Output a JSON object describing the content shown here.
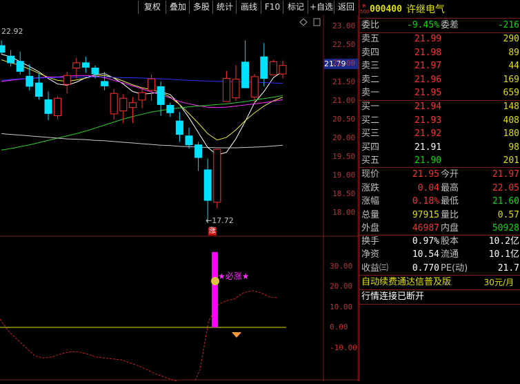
{
  "toolbar": {
    "buttons": [
      "复权",
      "叠加",
      "多股",
      "统计",
      "画线",
      "F10",
      "标记",
      "+自选",
      "返回"
    ]
  },
  "chart_data": {
    "type": "candlestick",
    "y_ticks": [
      "23.00",
      "22.50",
      "22.00",
      "21.50",
      "21.00",
      "20.50",
      "20.00",
      "19.50",
      "19.00",
      "18.50",
      "18.00"
    ],
    "high_label": "22.92",
    "low_label": "17.72",
    "current_price_tag": "21.79",
    "limit_up_marker": "涨",
    "candles": [
      {
        "o": 22.48,
        "h": 22.62,
        "l": 22.25,
        "c": 22.3
      },
      {
        "o": 22.2,
        "h": 22.36,
        "l": 21.92,
        "c": 22.02
      },
      {
        "o": 22.06,
        "h": 22.32,
        "l": 21.7,
        "c": 21.79
      },
      {
        "o": 21.66,
        "h": 21.98,
        "l": 21.28,
        "c": 21.39
      },
      {
        "o": 21.48,
        "h": 21.73,
        "l": 21.03,
        "c": 21.12
      },
      {
        "o": 21.03,
        "h": 21.25,
        "l": 20.48,
        "c": 20.66
      },
      {
        "o": 20.6,
        "h": 21.12,
        "l": 20.5,
        "c": 21.07
      },
      {
        "o": 21.44,
        "h": 21.78,
        "l": 21.2,
        "c": 21.68
      },
      {
        "o": 21.88,
        "h": 22.15,
        "l": 21.6,
        "c": 22.02
      },
      {
        "o": 22.02,
        "h": 22.18,
        "l": 21.75,
        "c": 21.9
      },
      {
        "o": 21.88,
        "h": 21.95,
        "l": 21.6,
        "c": 21.72
      },
      {
        "o": 21.52,
        "h": 21.78,
        "l": 21.28,
        "c": 21.4
      },
      {
        "o": 20.65,
        "h": 21.32,
        "l": 20.5,
        "c": 21.2
      },
      {
        "o": 20.73,
        "h": 21.18,
        "l": 20.4,
        "c": 21.07
      },
      {
        "o": 20.82,
        "h": 21.1,
        "l": 20.4,
        "c": 20.95
      },
      {
        "o": 21.02,
        "h": 21.37,
        "l": 20.8,
        "c": 21.22
      },
      {
        "o": 21.28,
        "h": 21.71,
        "l": 21.0,
        "c": 21.59
      },
      {
        "o": 21.38,
        "h": 21.52,
        "l": 20.6,
        "c": 20.9
      },
      {
        "o": 20.88,
        "h": 20.95,
        "l": 20.57,
        "c": 20.68
      },
      {
        "o": 20.46,
        "h": 20.7,
        "l": 19.9,
        "c": 20.1
      },
      {
        "o": 20.06,
        "h": 20.28,
        "l": 19.72,
        "c": 19.82
      },
      {
        "o": 19.82,
        "h": 19.9,
        "l": 19.12,
        "c": 19.48
      },
      {
        "o": 19.15,
        "h": 19.45,
        "l": 17.72,
        "c": 18.33
      },
      {
        "o": 18.28,
        "h": 19.5,
        "l": 18.12,
        "c": 19.7
      },
      {
        "o": 20.98,
        "h": 21.8,
        "l": 20.98,
        "c": 21.6
      },
      {
        "o": 21.08,
        "h": 21.95,
        "l": 21.0,
        "c": 21.58
      },
      {
        "o": 22.04,
        "h": 22.62,
        "l": 21.35,
        "c": 21.35
      },
      {
        "o": 21.1,
        "h": 21.72,
        "l": 20.95,
        "c": 21.65
      },
      {
        "o": 22.18,
        "h": 22.55,
        "l": 21.38,
        "c": 21.6
      },
      {
        "o": 21.7,
        "h": 22.1,
        "l": 21.75,
        "c": 22.05
      },
      {
        "o": 21.72,
        "h": 22.08,
        "l": 21.6,
        "c": 21.95
      }
    ],
    "ma_series": [
      {
        "color": "#ffffff",
        "values": [
          22.25,
          22.18,
          22.05,
          21.92,
          21.78,
          21.6,
          21.45,
          21.42,
          21.5,
          21.62,
          21.7,
          21.73,
          21.61,
          21.45,
          21.25,
          21.18,
          21.2,
          21.24,
          21.17,
          20.9,
          20.55,
          20.15,
          19.75,
          19.55,
          19.62,
          19.98,
          20.45,
          20.95,
          21.25,
          21.62,
          21.79
        ]
      },
      {
        "color": "#e8e840",
        "values": [
          22.1,
          22.02,
          21.95,
          21.85,
          21.74,
          21.63,
          21.55,
          21.52,
          21.56,
          21.61,
          21.66,
          21.68,
          21.62,
          21.53,
          21.43,
          21.35,
          21.3,
          21.23,
          21.1,
          20.9,
          20.66,
          20.4,
          20.12,
          19.95,
          20.02,
          20.22,
          20.47,
          20.68,
          20.86,
          21.0,
          21.1
        ]
      },
      {
        "color": "#ff30ff",
        "values": [
          21.52,
          21.55,
          21.58,
          21.6,
          21.62,
          21.64,
          21.64,
          21.66,
          21.68,
          21.68,
          21.66,
          21.62,
          21.55,
          21.48,
          21.4,
          21.32,
          21.24,
          21.16,
          21.08,
          20.98,
          20.92,
          20.87,
          20.83,
          20.82,
          20.83,
          20.86,
          20.89,
          20.92,
          20.95,
          20.99,
          21.03
        ]
      },
      {
        "color": "#30d030",
        "values": [
          19.68,
          19.72,
          19.77,
          19.82,
          19.88,
          19.94,
          20.0,
          20.06,
          20.12,
          20.19,
          20.27,
          20.35,
          20.43,
          20.51,
          20.58,
          20.64,
          20.7,
          20.74,
          20.78,
          20.81,
          20.84,
          20.86,
          20.88,
          20.9,
          20.92,
          20.95,
          20.98,
          21.02,
          21.06,
          21.1,
          21.14
        ]
      },
      {
        "color": "#3030ff",
        "values": [
          21.55,
          21.57,
          21.59,
          21.6,
          21.61,
          21.62,
          21.63,
          21.63,
          21.64,
          21.64,
          21.64,
          21.64,
          21.63,
          21.62,
          21.62,
          21.61,
          21.6,
          21.59,
          21.58,
          21.56,
          21.55,
          21.54,
          21.53,
          21.52,
          21.52,
          21.51,
          21.51,
          21.5,
          21.49,
          21.48,
          21.47
        ]
      },
      {
        "color": "#c8c8c8",
        "values": [
          20.12,
          20.1,
          20.08,
          20.06,
          20.04,
          20.02,
          20.0,
          19.98,
          19.97,
          19.96,
          19.94,
          19.93,
          19.91,
          19.89,
          19.87,
          19.85,
          19.83,
          19.81,
          19.8,
          19.78,
          19.77,
          19.76,
          19.75,
          19.74,
          19.74,
          19.74,
          19.75,
          19.76,
          19.77,
          19.79,
          19.81
        ]
      }
    ],
    "indicator": {
      "y_ticks": [
        "30.00",
        "20.00",
        "10.00",
        "0.00",
        "-10.00"
      ],
      "signal_text": "★必涨★",
      "dashed_values": [
        4.0,
        -2.0,
        -6.0,
        -10.0,
        -14.0,
        -15.0,
        -14.5,
        -13.0,
        -12.0,
        -12.0,
        -13.0,
        -14.5,
        -15.0,
        -15.5,
        -16.0,
        -17.5,
        -19.0,
        -21.0,
        -23.0,
        -24.5,
        -26.0,
        -27.0,
        -30.0,
        -21.0,
        3.0,
        11.0,
        13.0,
        14.0,
        17.0,
        18.0,
        17.0,
        15.0,
        14.5
      ],
      "zero_line": 0,
      "bar_range": [
        0,
        37
      ]
    }
  },
  "quote": {
    "code": "000400",
    "name": "许继电气",
    "badge_top": "R",
    "badge_bottom": "500",
    "weibi_label": "委比",
    "weibi": "-9.45%",
    "weicha_label": "委差",
    "weicha": "-216",
    "asks": [
      {
        "label": "卖五",
        "price": "21.99",
        "vol": "290"
      },
      {
        "label": "卖四",
        "price": "21.98",
        "vol": "89"
      },
      {
        "label": "卖三",
        "price": "21.97",
        "vol": "44"
      },
      {
        "label": "卖二",
        "price": "21.96",
        "vol": "169"
      },
      {
        "label": "卖一",
        "price": "21.95",
        "vol": "659"
      }
    ],
    "bids": [
      {
        "label": "买一",
        "price": "21.94",
        "vol": "148"
      },
      {
        "label": "买二",
        "price": "21.93",
        "vol": "408"
      },
      {
        "label": "买三",
        "price": "21.92",
        "vol": "180"
      },
      {
        "label": "买四",
        "price": "21.91",
        "vol": "98"
      },
      {
        "label": "买五",
        "price": "21.90",
        "vol": "201"
      }
    ],
    "stats": [
      {
        "l1": "现价",
        "v1": "21.95",
        "l2": "今开",
        "v2": "21.97"
      },
      {
        "l1": "涨跌",
        "v1": "0.04",
        "l2": "最高",
        "v2": "22.05"
      },
      {
        "l1": "涨幅",
        "v1": "0.18%",
        "l2": "最低",
        "v2": "21.60"
      },
      {
        "l1": "总量",
        "v1": "97915",
        "l2": "量比",
        "v2": "0.57"
      },
      {
        "l1": "外盘",
        "v1": "46987",
        "l2": "内盘",
        "v2": "50928"
      }
    ],
    "fund": [
      {
        "l1": "换手",
        "v1": "0.97%",
        "l2": "股本",
        "v2": "10.2亿"
      },
      {
        "l1": "净资",
        "v1": "10.54",
        "l2": "流通",
        "v2": "10.1亿"
      },
      {
        "l1": "收益㈢",
        "v1": "0.770",
        "l2": "PE(动)",
        "v2": "21.7"
      }
    ],
    "promo": "自动续费通达信普及版",
    "promo_price": "30元/月",
    "status": "行情连接已断开"
  },
  "colors": {
    "up": "#ff3030",
    "down": "#00e0ff",
    "grid": "#7a1a1a"
  }
}
